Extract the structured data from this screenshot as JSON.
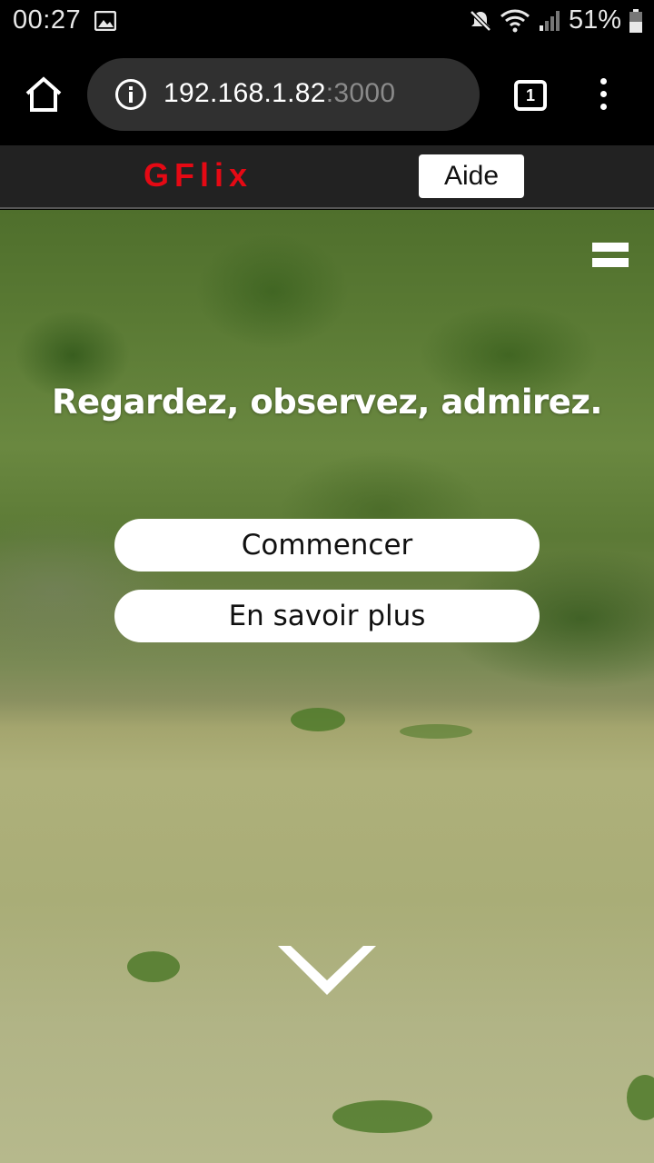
{
  "status_bar": {
    "time": "00:27",
    "battery_percent": "51%",
    "icons": [
      "gallery-icon",
      "mute-icon",
      "wifi-icon",
      "signal-icon",
      "battery-icon"
    ]
  },
  "browser": {
    "url_host": "192.168.1.82",
    "url_port": ":3000",
    "tab_count": "1",
    "icons": [
      "home-icon",
      "info-icon",
      "tab-switcher-icon",
      "overflow-menu-icon"
    ]
  },
  "site": {
    "logo": "GFlix",
    "help_label": "Aide",
    "brand_color": "#e50914"
  },
  "hero": {
    "headline": "Regardez, observez, admirez.",
    "start_label": "Commencer",
    "learn_more_label": "En savoir plus",
    "icons": [
      "menu-icon",
      "chevron-down-icon"
    ]
  }
}
